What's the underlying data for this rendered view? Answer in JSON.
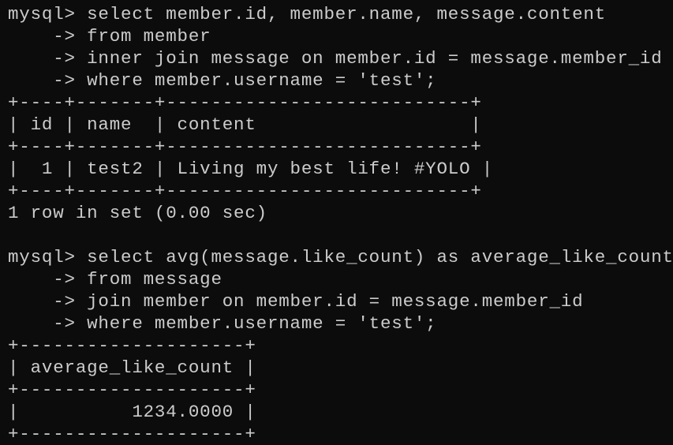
{
  "terminal": {
    "lines": [
      "mysql> select member.id, member.name, message.content",
      "    -> from member",
      "    -> inner join message on member.id = message.member_id",
      "    -> where member.username = 'test';",
      "+----+-------+---------------------------+",
      "| id | name  | content                   |",
      "+----+-------+---------------------------+",
      "|  1 | test2 | Living my best life! #YOLO |",
      "+----+-------+---------------------------+",
      "1 row in set (0.00 sec)",
      "",
      "mysql> select avg(message.like_count) as average_like_count",
      "    -> from message",
      "    -> join member on member.id = message.member_id",
      "    -> where member.username = 'test';",
      "+--------------------+",
      "| average_like_count |",
      "+--------------------+",
      "|          1234.0000 |",
      "+--------------------+"
    ]
  },
  "colors": {
    "background": "#0c0c0c",
    "foreground": "#cccccc"
  }
}
